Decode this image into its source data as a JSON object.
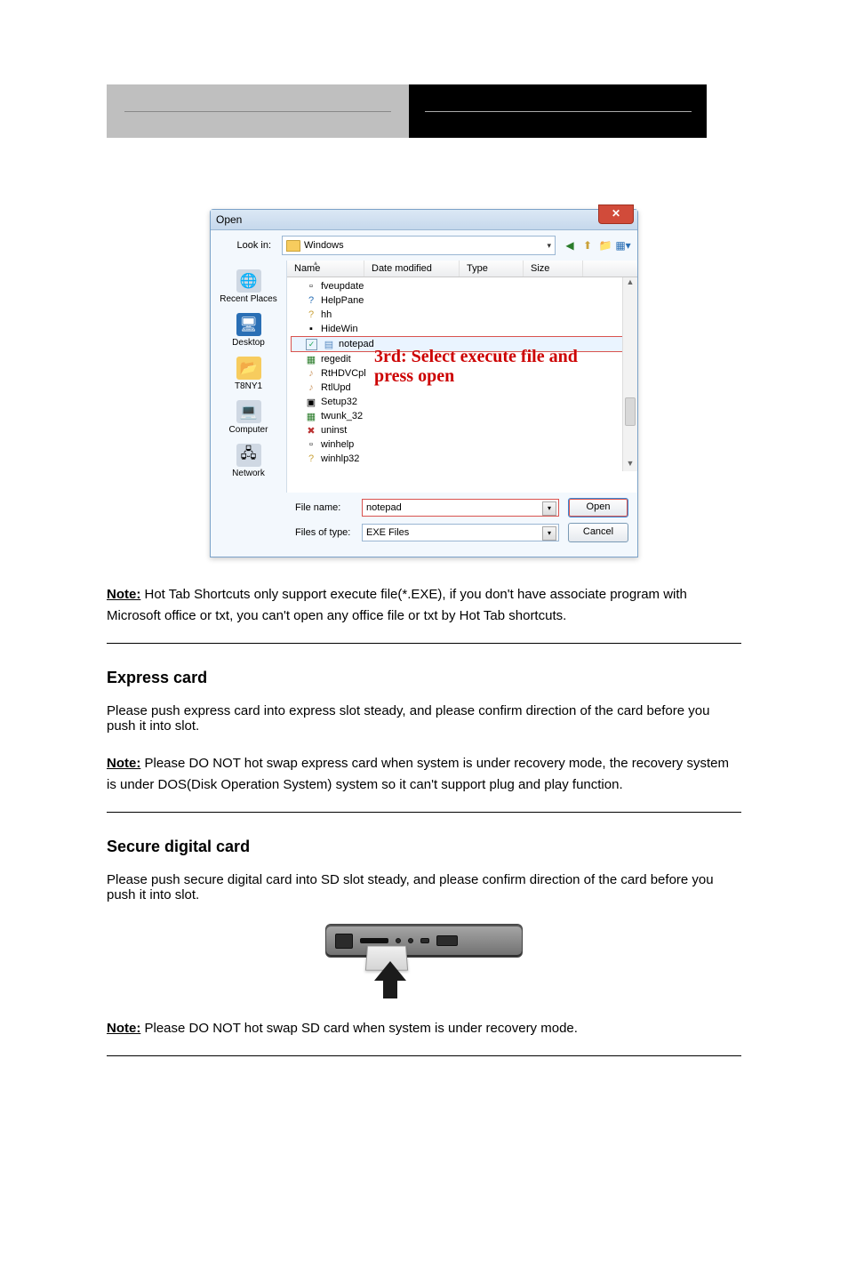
{
  "header": {
    "left": "",
    "right": ""
  },
  "dialog": {
    "title": "Open",
    "lookin_label": "Look in:",
    "lookin_value": "Windows",
    "columns": {
      "name": "Name",
      "date": "Date modified",
      "type": "Type",
      "size": "Size"
    },
    "places": [
      "Recent Places",
      "Desktop",
      "T8NY1",
      "Computer",
      "Network"
    ],
    "files": [
      {
        "name": "fveupdate",
        "icon": "app"
      },
      {
        "name": "HelpPane",
        "icon": "help"
      },
      {
        "name": "hh",
        "icon": "chm"
      },
      {
        "name": "HideWin",
        "icon": "cmd"
      },
      {
        "name": "notepad",
        "icon": "txt",
        "selected": true
      },
      {
        "name": "regedit",
        "icon": "reg"
      },
      {
        "name": "RtHDVCpl",
        "icon": "audio"
      },
      {
        "name": "RtlUpd",
        "icon": "audio"
      },
      {
        "name": "Setup32",
        "icon": "setup"
      },
      {
        "name": "twunk_32",
        "icon": "twain"
      },
      {
        "name": "uninst",
        "icon": "uninst"
      },
      {
        "name": "winhelp",
        "icon": "app"
      },
      {
        "name": "winhlp32",
        "icon": "chm"
      }
    ],
    "filename_label": "File name:",
    "filename_value": "notepad",
    "filetype_label": "Files of type:",
    "filetype_value": "EXE Files",
    "open_btn": "Open",
    "cancel_btn": "Cancel",
    "annotation_line1": "3rd: Select execute file and",
    "annotation_line2": "press open"
  },
  "para1_note": "Note:",
  "para1_text": " Hot Tab Shortcuts only support execute file(*.EXE), if you don't have associate program with Microsoft office or txt, you can't open any office file or txt by Hot Tab shortcuts.",
  "sect_express": "Express card",
  "express_text": "Please push express card into express slot steady, and please confirm direction of the card before you push it into slot.",
  "para2_note": "Note:",
  "para2_text": " Please DO NOT hot swap express card when system is under recovery mode, the recovery system is under DOS(Disk Operation System) system so it can't support plug and play function.",
  "sect_sd": "Secure digital card",
  "sd_text": "Please push secure digital card into SD slot steady, and please confirm direction of the card before you push it into slot.",
  "para3_note": "Note:",
  "para3_text": " Please DO NOT hot swap SD card when system is under recovery mode."
}
